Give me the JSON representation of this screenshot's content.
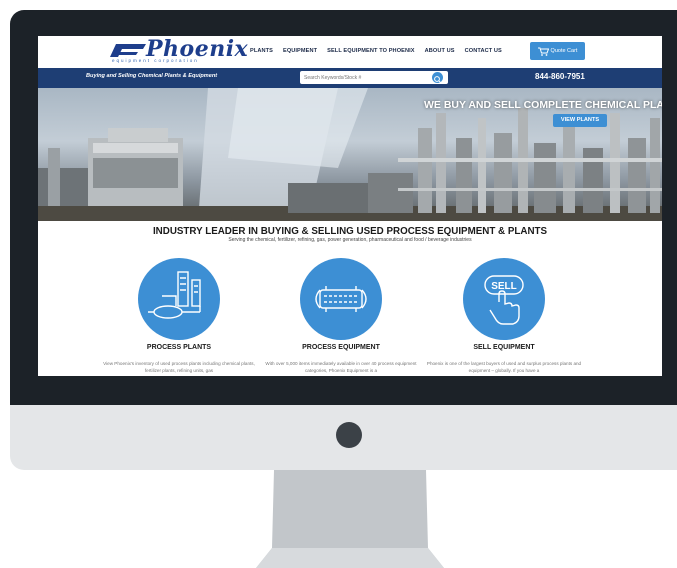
{
  "logo": {
    "name": "Phoenix",
    "subtitle": "equipment corporation"
  },
  "nav": {
    "items": [
      "PLANTS",
      "EQUIPMENT",
      "SELL EQUIPMENT TO PHOENIX",
      "ABOUT US",
      "CONTACT US"
    ]
  },
  "cart": {
    "label": "Quote Cart"
  },
  "header": {
    "tagline": "Buying and Selling Chemical Plants & Equipment",
    "search_placeholder": "Search Keywords/Stock #",
    "phone": "844-860-7951"
  },
  "hero": {
    "headline": "WE BUY AND SELL COMPLETE CHEMICAL PLANTS F",
    "button_label": "VIEW PLANTS"
  },
  "main": {
    "heading": "INDUSTRY LEADER IN BUYING & SELLING USED PROCESS EQUIPMENT & PLANTS",
    "subheading": "Serving the chemical, fertilizer, refining, gas, power generation, pharmaceutical and food / beverage industries"
  },
  "services": [
    {
      "title": "PROCESS PLANTS",
      "desc": "View Phoenix's inventory of used process plants including chemical plants, fertilizer plants, refining units, gas",
      "icon": "process-plant-icon"
    },
    {
      "title": "PROCESS EQUIPMENT",
      "desc": "With over 5,000 items immediately available in over 40 process equipment categories, Phoenix Equipment is a",
      "icon": "heat-exchanger-icon"
    },
    {
      "title": "SELL EQUIPMENT",
      "desc": "Phoenix is one of the largest buyers of used and surplus process plants and equipment – globally. If you have a",
      "icon": "sell-hand-icon",
      "icon_text": "SELL"
    }
  ],
  "colors": {
    "accent": "#3d8fd4",
    "navy": "#1e3e74",
    "bezel": "#1c2228",
    "chin": "#e4e6e8",
    "stand": "#bfc3c7"
  }
}
